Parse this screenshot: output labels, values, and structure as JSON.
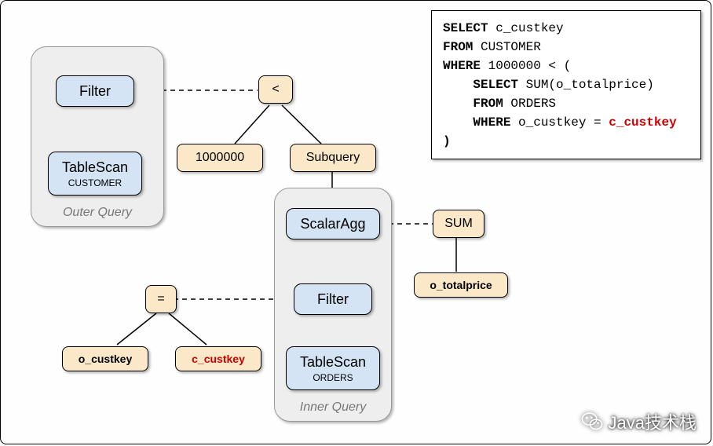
{
  "sql": {
    "line1_kw1": "SELECT",
    "line1_t": " c_custkey",
    "line2_kw1": "FROM",
    "line2_t": " CUSTOMER",
    "line3_kw1": "WHERE",
    "line3_t": " 1000000 < (",
    "line4_ind": "    ",
    "line4_kw1": "SELECT",
    "line4_t": " SUM(o_totalprice)",
    "line5_ind": "    ",
    "line5_kw1": "FROM",
    "line5_t": " ORDERS",
    "line6_ind": "    ",
    "line6_kw1": "WHERE",
    "line6_t": " o_custkey = ",
    "line6_red": "c_custkey",
    "line7_kw": ")"
  },
  "outer": {
    "title": "Outer Query",
    "filter": "Filter",
    "tablescan": "TableScan",
    "tablename": "CUSTOMER"
  },
  "inner": {
    "title": "Inner Query",
    "scalaragg": "ScalarAgg",
    "filter": "Filter",
    "tablescan": "TableScan",
    "tablename": "ORDERS"
  },
  "labels": {
    "lt": "<",
    "million": "1000000",
    "subquery": "Subquery",
    "sum": "SUM",
    "totalprice": "o_totalprice",
    "eq": "=",
    "ocustkey": "o_custkey",
    "ccustkey": "c_custkey"
  },
  "watermark": "Java技术栈"
}
